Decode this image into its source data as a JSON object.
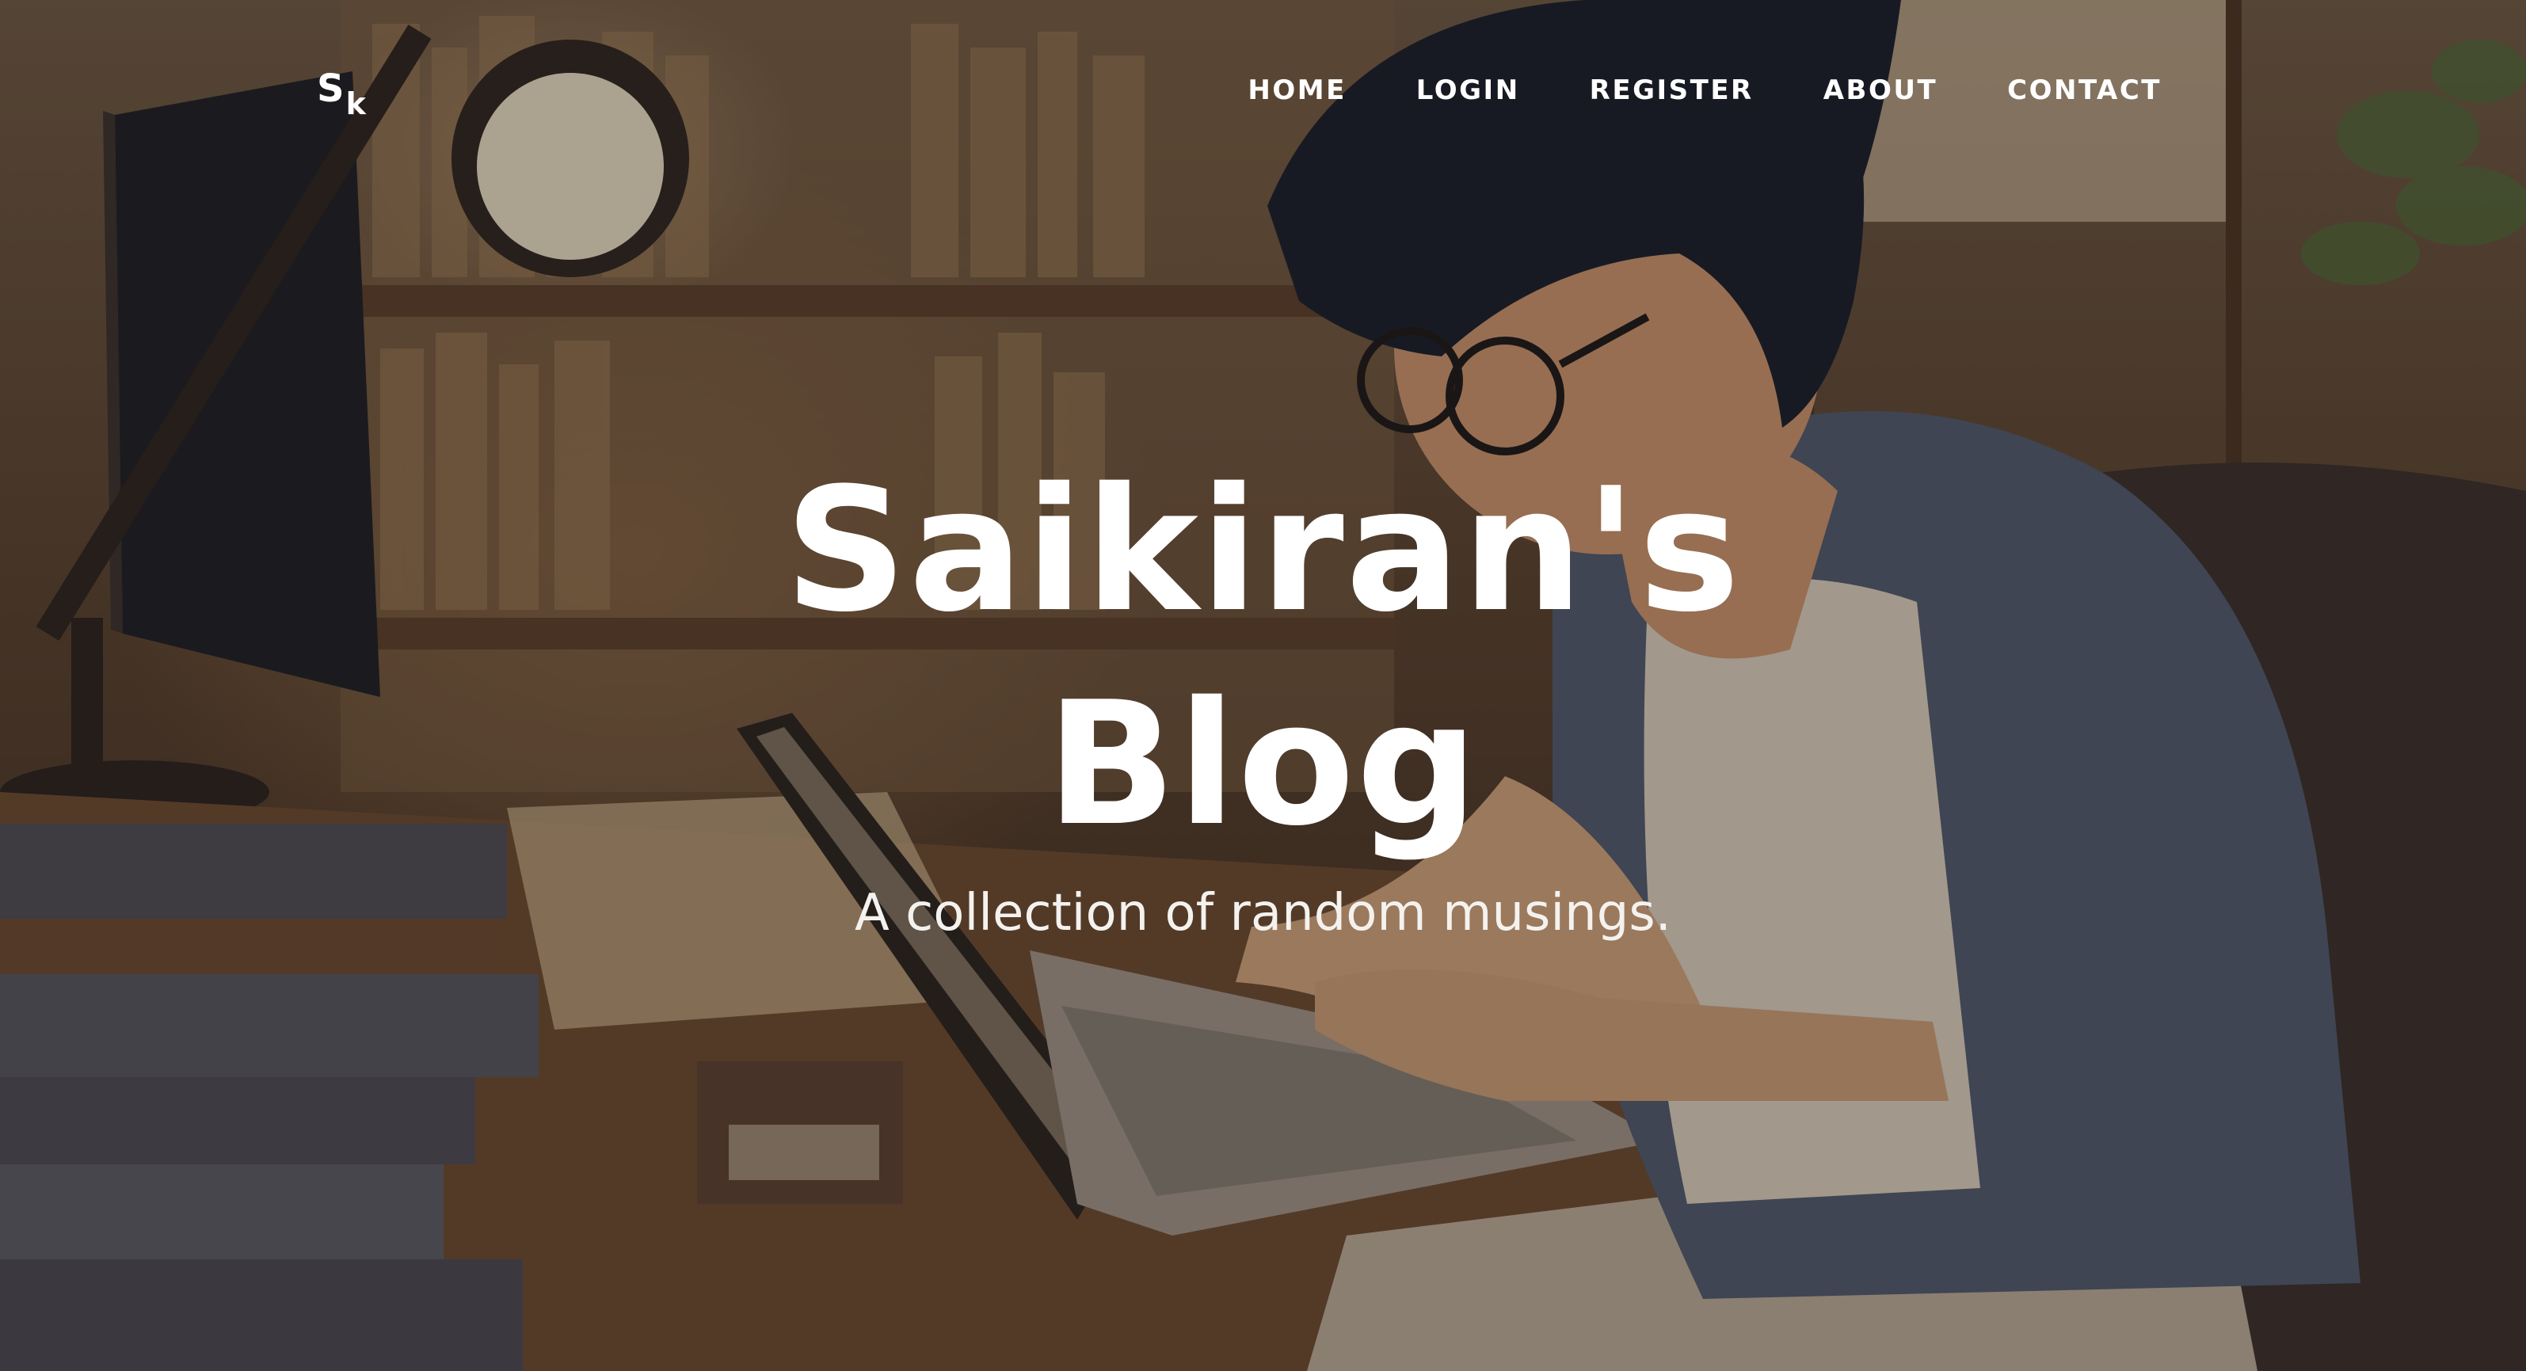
{
  "nav": {
    "brand_main": "S",
    "brand_sub": "k",
    "links": [
      {
        "label": "HOME"
      },
      {
        "label": "LOGIN"
      },
      {
        "label": "REGISTER"
      },
      {
        "label": "ABOUT"
      },
      {
        "label": "CONTACT"
      }
    ]
  },
  "hero": {
    "title_line1": "Saikiran's",
    "title_line2": "Blog",
    "subtitle": "A collection of random musings."
  },
  "colors": {
    "text": "#ffffff",
    "overlay": "#14100e"
  }
}
